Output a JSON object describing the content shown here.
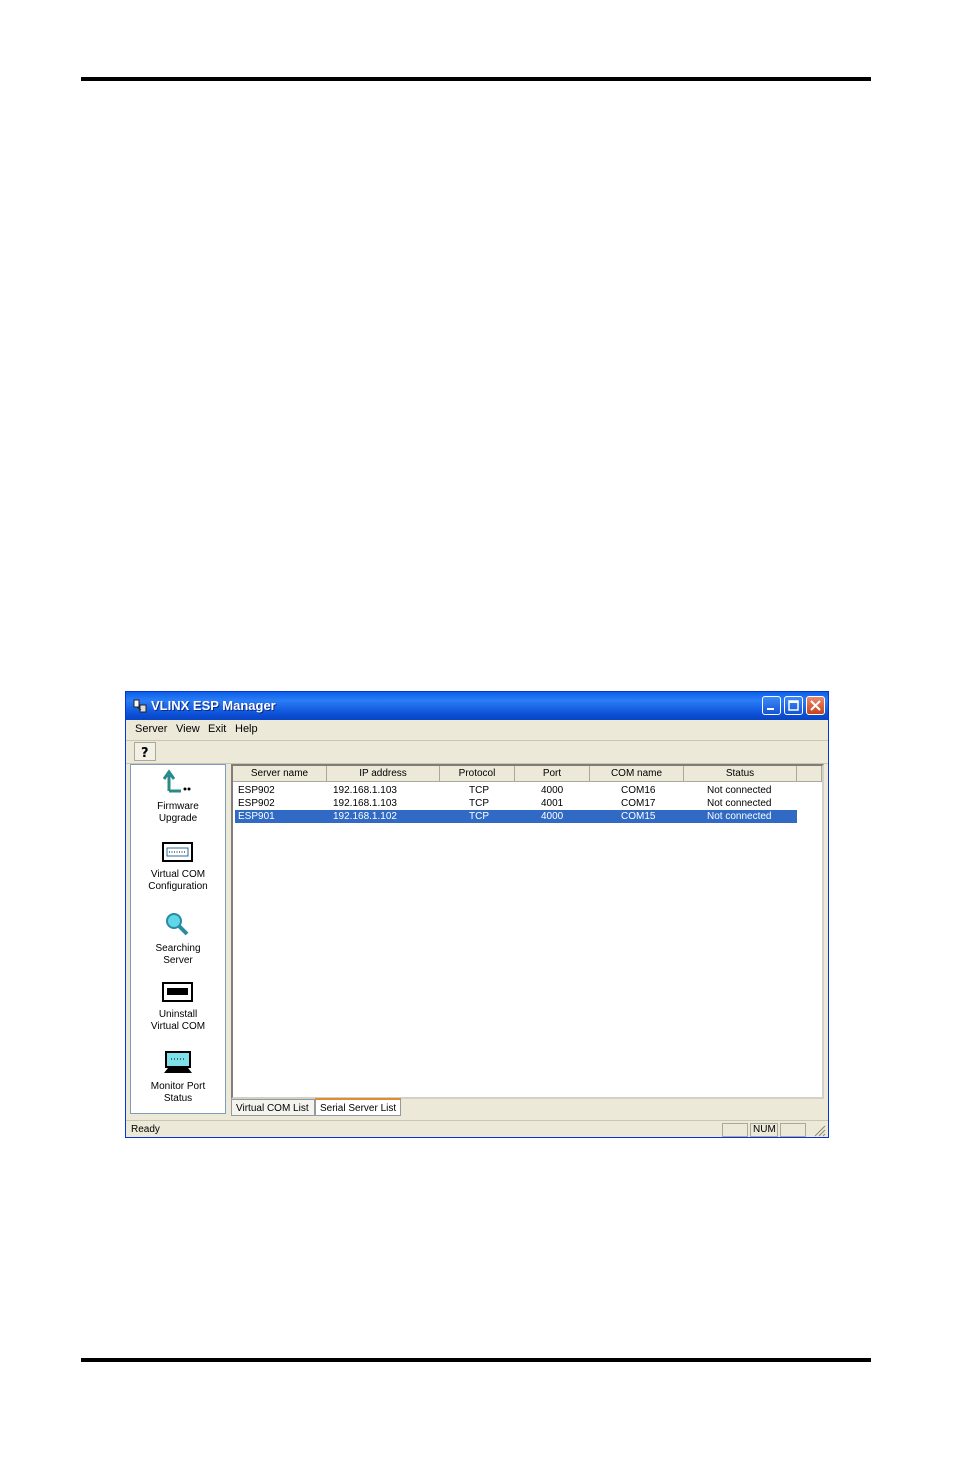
{
  "window": {
    "title": "VLINX ESP Manager"
  },
  "menu": [
    "Server",
    "View",
    "Exit",
    "Help"
  ],
  "sidebar": [
    {
      "label_line1": "Firmware",
      "label_line2": "Upgrade",
      "icon": "firmware-upgrade-icon"
    },
    {
      "label_line1": "Virtual COM",
      "label_line2": "Configuration",
      "icon": "virtual-com-config-icon"
    },
    {
      "label_line1": "Searching",
      "label_line2": "Server",
      "icon": "search-icon"
    },
    {
      "label_line1": "Uninstall",
      "label_line2": "Virtual COM",
      "icon": "uninstall-icon"
    },
    {
      "label_line1": "Monitor Port",
      "label_line2": "Status",
      "icon": "monitor-icon"
    }
  ],
  "table": {
    "headers": [
      "Server name",
      "IP address",
      "Protocol",
      "Port",
      "COM name",
      "Status"
    ],
    "rows": [
      [
        "ESP902",
        "192.168.1.103",
        "TCP",
        "4000",
        "COM16",
        "Not connected"
      ],
      [
        "ESP902",
        "192.168.1.103",
        "TCP",
        "4001",
        "COM17",
        "Not connected"
      ],
      [
        "ESP901",
        "192.168.1.102",
        "TCP",
        "4000",
        "COM15",
        "Not connected"
      ]
    ],
    "selected_row": 2
  },
  "tabs": [
    "Virtual COM List",
    "Serial Server List"
  ],
  "active_tab": 1,
  "status": {
    "text": "Ready",
    "num": "NUM"
  },
  "colors": {
    "titlebar": "#0a5fe8",
    "selection": "#316ac5",
    "chrome": "#ece9d8"
  }
}
